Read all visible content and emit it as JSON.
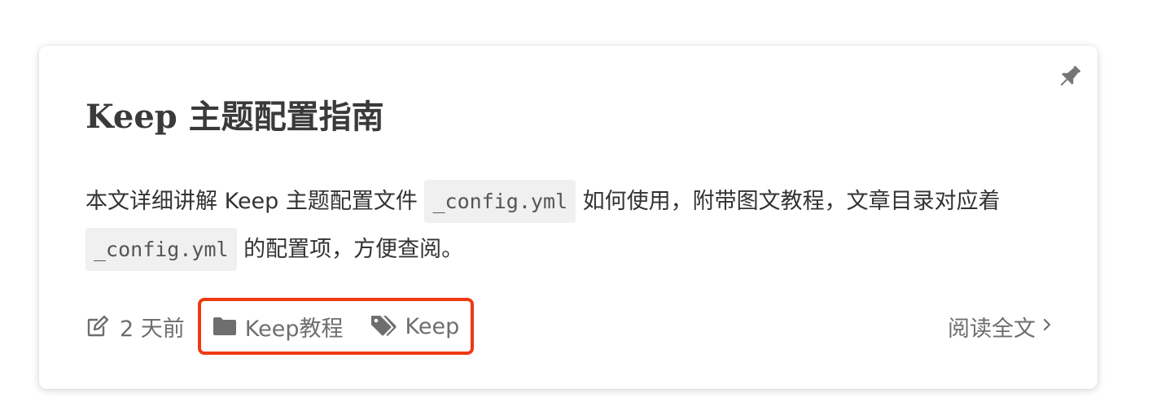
{
  "post": {
    "title": "Keep 主题配置指南",
    "excerpt": {
      "text_1": "本文详细讲解 Keep 主题配置文件 ",
      "code_1": "_config.yml",
      "text_2": " 如何使用，附带图文教程，文章目录对应着 ",
      "code_2": "_config.yml",
      "text_3": " 的配置项，方便查阅。"
    },
    "meta": {
      "updated": "2 天前",
      "category": "Keep教程",
      "tag": "Keep"
    },
    "read_more": "阅读全文"
  },
  "icons": {
    "pin": "thumbtack-icon",
    "updated": "edit-icon",
    "category": "folder-icon",
    "tag": "tags-icon",
    "read_more": "chevron-right-icon"
  },
  "colors": {
    "highlight_border": "#ee3a12",
    "meta_text": "#6e6e6e",
    "title": "#3a3a3a"
  }
}
